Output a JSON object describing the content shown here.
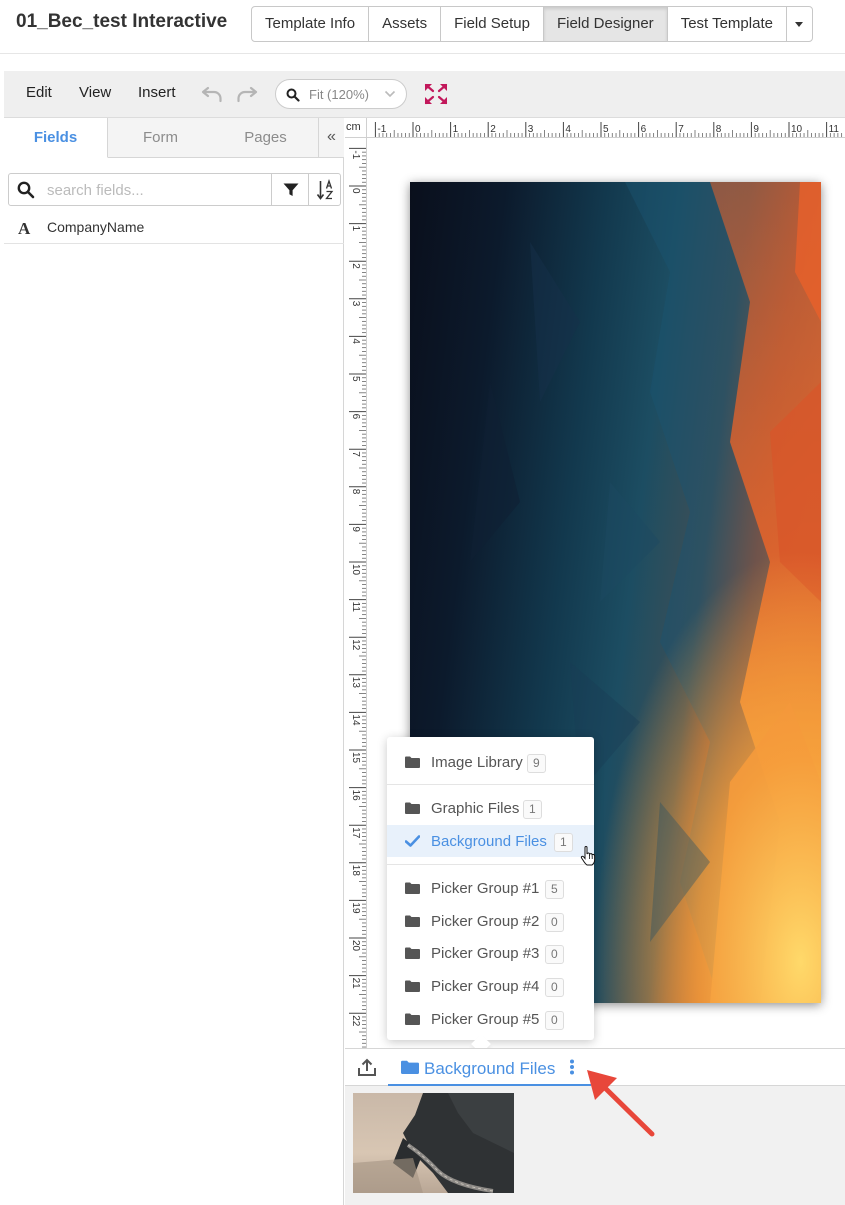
{
  "header": {
    "title": "01_Bec_test Interactive",
    "tabs": [
      {
        "label": "Template Info"
      },
      {
        "label": "Assets"
      },
      {
        "label": "Field Setup"
      },
      {
        "label": "Field Designer",
        "active": true
      },
      {
        "label": "Test Template"
      }
    ]
  },
  "toolbar": {
    "menus": [
      "Edit",
      "View",
      "Insert"
    ],
    "zoom_value": "Fit (120%)",
    "icons": [
      "undo-icon",
      "redo-icon",
      "search-icon",
      "chevron-down-icon",
      "fit-to-screen-icon"
    ],
    "accent_color": "#c2185b"
  },
  "left_panel": {
    "tabs": [
      "Fields",
      "Form",
      "Pages"
    ],
    "active_tab": "Fields",
    "collapse_glyph": "«",
    "search_placeholder": "search fields...",
    "fields": [
      {
        "type_glyph": "A",
        "name": "CompanyName"
      }
    ]
  },
  "ruler": {
    "unit": "cm",
    "h_labels": [
      "-1",
      "0",
      "1",
      "2",
      "3",
      "4",
      "5",
      "6",
      "7",
      "8",
      "9",
      "10",
      "11"
    ],
    "v_labels": [
      "-1",
      "0",
      "1",
      "2",
      "3",
      "4",
      "5",
      "6",
      "7",
      "8",
      "9",
      "10",
      "11",
      "12",
      "13",
      "14",
      "15",
      "16",
      "17",
      "18",
      "19",
      "20",
      "21",
      "22"
    ]
  },
  "asset_menu": {
    "groups": [
      [
        {
          "label": "Image Library",
          "count": "9",
          "icon": "folder-icon"
        }
      ],
      [
        {
          "label": "Graphic Files",
          "count": "1",
          "icon": "folder-icon"
        },
        {
          "label": "Background Files",
          "count": "1",
          "icon": "check-icon",
          "selected": true
        }
      ],
      [
        {
          "label": "Picker Group #1",
          "count": "5",
          "icon": "folder-icon"
        },
        {
          "label": "Picker Group #2",
          "count": "0",
          "icon": "folder-icon"
        },
        {
          "label": "Picker Group #3",
          "count": "0",
          "icon": "folder-icon"
        },
        {
          "label": "Picker Group #4",
          "count": "0",
          "icon": "folder-icon"
        },
        {
          "label": "Picker Group #5",
          "count": "0",
          "icon": "folder-icon"
        }
      ]
    ]
  },
  "asset_bar": {
    "active_folder": "Background Files",
    "icons": [
      "upload-icon",
      "folder-icon",
      "more-vertical-icon"
    ]
  },
  "colors": {
    "accent_blue": "#4a90e2",
    "annotation_red": "#e8473a"
  }
}
